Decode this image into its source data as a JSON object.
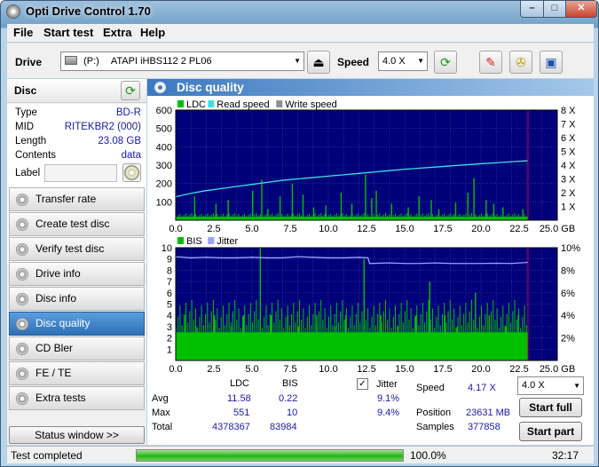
{
  "window": {
    "title": "Opti Drive Control 1.70",
    "min": "–",
    "max": "□",
    "close": "✕"
  },
  "menu": [
    "File",
    "Start test",
    "Extra",
    "Help"
  ],
  "toolbar": {
    "drive_label": "Drive",
    "drive_letter": "(P:)",
    "drive_value": "ATAPI iHBS112   2 PL06",
    "speed_label": "Speed",
    "speed_value": "4.0 X"
  },
  "disc": {
    "header": "Disc",
    "fields": [
      {
        "key": "Type",
        "value": "BD-R"
      },
      {
        "key": "MID",
        "value": "RITEKBR2 (000)"
      },
      {
        "key": "Length",
        "value": "23.08 GB"
      },
      {
        "key": "Contents",
        "value": "data"
      },
      {
        "key": "Label",
        "value": ""
      }
    ]
  },
  "nav": [
    {
      "label": "Transfer rate",
      "active": false
    },
    {
      "label": "Create test disc",
      "active": false
    },
    {
      "label": "Verify test disc",
      "active": false
    },
    {
      "label": "Drive info",
      "active": false
    },
    {
      "label": "Disc info",
      "active": false
    },
    {
      "label": "Disc quality",
      "active": true
    },
    {
      "label": "CD Bler",
      "active": false
    },
    {
      "label": "FE / TE",
      "active": false
    },
    {
      "label": "Extra tests",
      "active": false
    }
  ],
  "status_window_btn": "Status window >>",
  "panel_title": "Disc quality",
  "chart_data": [
    {
      "type": "bar",
      "legend": [
        "LDC",
        "Read speed",
        "Write speed"
      ],
      "x_ticks": [
        "0.0",
        "2.5",
        "5.0",
        "7.5",
        "10.0",
        "12.5",
        "15.0",
        "17.5",
        "20.0",
        "22.5",
        "25.0 GB"
      ],
      "y_ticks_left": [
        "100",
        "200",
        "300",
        "400",
        "500",
        "600"
      ],
      "y_ticks_right": [
        "1 X",
        "2 X",
        "3 X",
        "4 X",
        "5 X",
        "6 X",
        "7 X",
        "8 X"
      ],
      "xlim": [
        0,
        25
      ],
      "ylim": [
        0,
        600
      ],
      "y2lim": [
        0,
        8
      ],
      "disc_end_gb": 23.08,
      "ldc_baseline": 18,
      "ldc_spikes": [
        [
          1.2,
          130
        ],
        [
          2.6,
          90
        ],
        [
          3.4,
          110
        ],
        [
          5.0,
          160
        ],
        [
          5.6,
          220
        ],
        [
          6.0,
          60
        ],
        [
          6.8,
          130
        ],
        [
          7.6,
          200
        ],
        [
          8.3,
          140
        ],
        [
          9.0,
          70
        ],
        [
          9.8,
          80
        ],
        [
          10.8,
          150
        ],
        [
          11.5,
          90
        ],
        [
          12.4,
          250
        ],
        [
          12.8,
          120
        ],
        [
          13.1,
          160
        ],
        [
          14.1,
          90
        ],
        [
          15.2,
          70
        ],
        [
          15.9,
          130
        ],
        [
          16.7,
          110
        ],
        [
          17.2,
          60
        ],
        [
          18.3,
          95
        ],
        [
          19.1,
          150
        ],
        [
          19.5,
          230
        ],
        [
          20.3,
          110
        ],
        [
          20.8,
          90
        ],
        [
          21.4,
          70
        ],
        [
          22.7,
          60
        ]
      ],
      "read_speed": [
        [
          0,
          1.7
        ],
        [
          1,
          1.95
        ],
        [
          2,
          2.15
        ],
        [
          3,
          2.3
        ],
        [
          4,
          2.45
        ],
        [
          5,
          2.6
        ],
        [
          6,
          2.75
        ],
        [
          7,
          2.9
        ],
        [
          8,
          3.0
        ],
        [
          9,
          3.1
        ],
        [
          10,
          3.2
        ],
        [
          11,
          3.3
        ],
        [
          12,
          3.4
        ],
        [
          13,
          3.5
        ],
        [
          14,
          3.6
        ],
        [
          15,
          3.7
        ],
        [
          16,
          3.78
        ],
        [
          17,
          3.86
        ],
        [
          18,
          3.94
        ],
        [
          19,
          4.02
        ],
        [
          20,
          4.1
        ],
        [
          21,
          4.17
        ],
        [
          22,
          4.25
        ],
        [
          23.08,
          4.32
        ]
      ]
    },
    {
      "type": "bar",
      "legend": [
        "BIS",
        "Jitter"
      ],
      "x_ticks": [
        "0.0",
        "2.5",
        "5.0",
        "7.5",
        "10.0",
        "12.5",
        "15.0",
        "17.5",
        "20.0",
        "22.5",
        "25.0 GB"
      ],
      "y_ticks_left": [
        "1",
        "2",
        "3",
        "4",
        "5",
        "6",
        "7",
        "8",
        "9",
        "10"
      ],
      "y_ticks_right": [
        "2%",
        "4%",
        "6%",
        "8%",
        "10%"
      ],
      "xlim": [
        0,
        25
      ],
      "ylim": [
        0,
        10
      ],
      "y2lim": [
        0,
        10
      ],
      "disc_end_gb": 23.08,
      "bis_baseline": 2.5,
      "bis_spikes": [
        [
          0.6,
          4
        ],
        [
          1.3,
          3
        ],
        [
          2.5,
          4
        ],
        [
          3.6,
          3
        ],
        [
          4.4,
          4
        ],
        [
          5.5,
          10
        ],
        [
          6.2,
          4
        ],
        [
          7.3,
          4
        ],
        [
          8.0,
          3
        ],
        [
          9.2,
          4
        ],
        [
          10.4,
          3
        ],
        [
          11.1,
          4
        ],
        [
          12.3,
          9
        ],
        [
          13.4,
          4
        ],
        [
          14.5,
          3
        ],
        [
          15.7,
          4
        ],
        [
          16.6,
          7
        ],
        [
          17.6,
          4
        ],
        [
          18.4,
          3
        ],
        [
          19.6,
          6
        ],
        [
          20.5,
          4
        ],
        [
          21.6,
          3
        ],
        [
          22.4,
          4
        ]
      ],
      "jitter": [
        [
          0,
          9.2
        ],
        [
          1,
          9.1
        ],
        [
          2,
          9.15
        ],
        [
          3,
          9.1
        ],
        [
          4,
          9.1
        ],
        [
          5,
          9.15
        ],
        [
          6,
          9.1
        ],
        [
          7,
          9.1
        ],
        [
          8,
          9.2
        ],
        [
          9,
          9.15
        ],
        [
          10,
          9.1
        ],
        [
          11,
          9.1
        ],
        [
          12,
          9.15
        ],
        [
          12.6,
          9.1
        ],
        [
          12.7,
          8.6
        ],
        [
          14,
          8.65
        ],
        [
          15,
          8.6
        ],
        [
          16,
          8.6
        ],
        [
          17,
          8.65
        ],
        [
          18,
          8.6
        ],
        [
          19,
          8.6
        ],
        [
          20,
          8.6
        ],
        [
          21,
          8.62
        ],
        [
          22,
          8.6
        ],
        [
          23.08,
          8.7
        ]
      ]
    }
  ],
  "stats": {
    "col_ldc": "LDC",
    "col_bis": "BIS",
    "jitter_label": "Jitter",
    "jitter_checked": "✓",
    "rows": [
      {
        "label": "Avg",
        "ldc": "11.58",
        "bis": "0.22",
        "jitter": "9.1%"
      },
      {
        "label": "Max",
        "ldc": "551",
        "bis": "10",
        "jitter": "9.4%"
      },
      {
        "label": "Total",
        "ldc": "4378367",
        "bis": "83984",
        "jitter": ""
      }
    ],
    "speed_label": "Speed",
    "speed_value": "4.17 X",
    "position_label": "Position",
    "position_value": "23631 MB",
    "samples_label": "Samples",
    "samples_value": "377858",
    "speed_select": "4.0 X",
    "start_full": "Start full",
    "start_part": "Start part"
  },
  "statusbar": {
    "text": "Test completed",
    "progress": 1.0,
    "percent": "100.0%",
    "time": "32:17"
  },
  "colors": {
    "plot_bg": "#00007a",
    "ldc": "#00c000",
    "read_speed": "#40e0e0",
    "jitter": "#a0a0ff",
    "grid": "#4a4ab0",
    "end_line": "#c00040"
  }
}
